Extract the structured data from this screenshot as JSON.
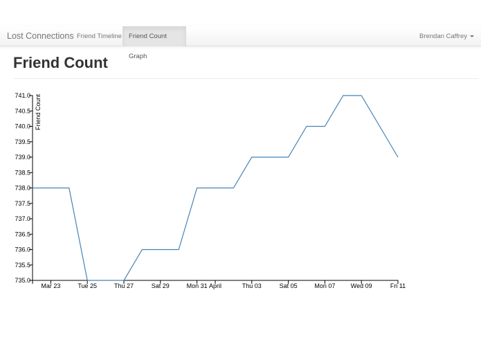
{
  "navbar": {
    "brand": "Lost Connections",
    "tabs": [
      {
        "label": "Friend Timeline",
        "active": false
      },
      {
        "label": "Friend Count Graph",
        "active": true
      }
    ],
    "user": "Brendan Caffrey"
  },
  "page": {
    "title": "Friend Count"
  },
  "chart_data": {
    "type": "line",
    "title": "",
    "xlabel": "",
    "ylabel": "Friend Count",
    "line_color": "#4682b4",
    "grid": false,
    "ylim": [
      735.0,
      741.0
    ],
    "xlim": [
      "Mar 22",
      "Apr 11"
    ],
    "y_ticks": [
      "735.0",
      "735.5",
      "736.0",
      "736.5",
      "737.0",
      "737.5",
      "738.0",
      "738.5",
      "739.0",
      "739.5",
      "740.0",
      "740.5",
      "741.0"
    ],
    "x_ticks": [
      {
        "date": "Mar 23",
        "label": "Mar 23"
      },
      {
        "date": "Mar 25",
        "label": "Tue 25"
      },
      {
        "date": "Mar 27",
        "label": "Thu 27"
      },
      {
        "date": "Mar 29",
        "label": "Sat 29"
      },
      {
        "date": "Mar 31",
        "label": "Mon 31"
      },
      {
        "date": "Apr 01",
        "label": "April"
      },
      {
        "date": "Apr 03",
        "label": "Thu 03"
      },
      {
        "date": "Apr 05",
        "label": "Sat 05"
      },
      {
        "date": "Apr 07",
        "label": "Mon 07"
      },
      {
        "date": "Apr 09",
        "label": "Wed 09"
      },
      {
        "date": "Apr 11",
        "label": "Fri 11"
      }
    ],
    "series": [
      {
        "points": [
          {
            "x": "Mar 22",
            "y": 738
          },
          {
            "x": "Mar 24",
            "y": 738
          },
          {
            "x": "Mar 25",
            "y": 735
          },
          {
            "x": "Mar 27",
            "y": 735
          },
          {
            "x": "Mar 28",
            "y": 736
          },
          {
            "x": "Mar 30",
            "y": 736
          },
          {
            "x": "Mar 31",
            "y": 738
          },
          {
            "x": "Apr 02",
            "y": 738
          },
          {
            "x": "Apr 03",
            "y": 739
          },
          {
            "x": "Apr 05",
            "y": 739
          },
          {
            "x": "Apr 06",
            "y": 740
          },
          {
            "x": "Apr 07",
            "y": 740
          },
          {
            "x": "Apr 08",
            "y": 741
          },
          {
            "x": "Apr 09",
            "y": 741
          },
          {
            "x": "Apr 11",
            "y": 739
          }
        ]
      }
    ]
  }
}
